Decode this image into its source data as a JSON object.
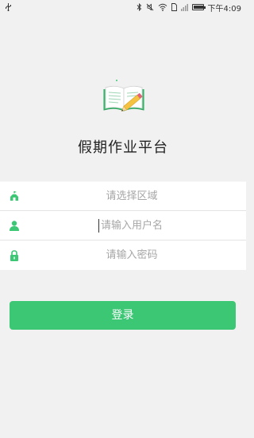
{
  "status_bar": {
    "usb_icon": "usb-icon",
    "time": "下午4:09"
  },
  "app": {
    "title": "假期作业平台",
    "logo_icon": "book-pencil-icon"
  },
  "form": {
    "region": {
      "placeholder": "请选择区域",
      "icon": "region-icon"
    },
    "username": {
      "placeholder": "请输入用户名",
      "icon": "user-icon"
    },
    "password": {
      "placeholder": "请输入密码",
      "icon": "lock-icon"
    }
  },
  "login_button": {
    "label": "登录"
  },
  "colors": {
    "accent": "#3cc775",
    "background": "#f1f1f1"
  }
}
